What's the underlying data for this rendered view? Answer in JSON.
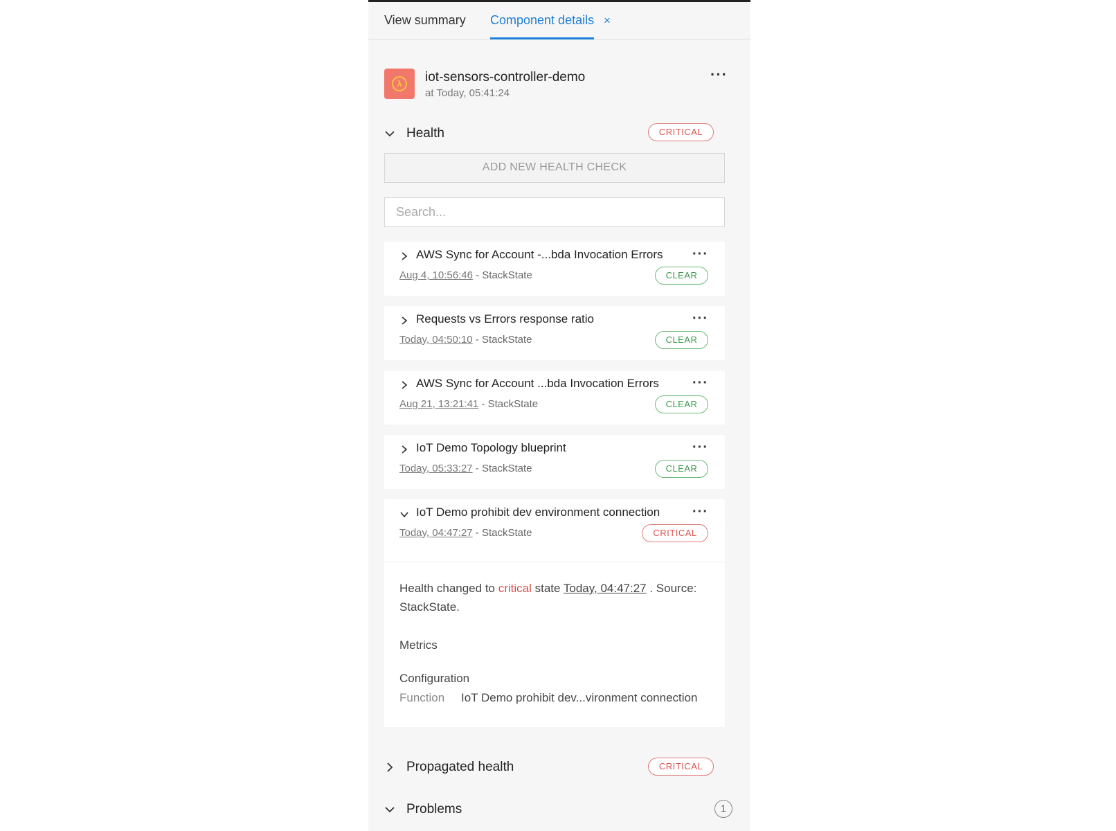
{
  "tabs": {
    "summary": "View summary",
    "details": "Component details",
    "close": "×"
  },
  "component": {
    "title": "iot-sensors-controller-demo",
    "time": "at Today, 05:41:24",
    "icon": "lambda-icon",
    "icon_color": "#f2786c"
  },
  "health": {
    "title": "Health",
    "state": "CRITICAL",
    "add_button": "ADD NEW HEALTH CHECK",
    "search_placeholder": "Search..."
  },
  "checks": [
    {
      "title": "AWS Sync for Account -...bda Invocation Errors",
      "time": "Aug 4, 10:56:46",
      "source": " - StackState",
      "state": "CLEAR"
    },
    {
      "title": "Requests vs Errors response ratio",
      "time": "Today, 04:50:10",
      "source": " - StackState",
      "state": "CLEAR"
    },
    {
      "title": "AWS Sync for Account ...bda Invocation Errors",
      "time": "Aug 21, 13:21:41",
      "source": " - StackState",
      "state": "CLEAR"
    },
    {
      "title": "IoT Demo Topology blueprint",
      "time": "Today, 05:33:27",
      "source": " - StackState",
      "state": "CLEAR"
    },
    {
      "title": "IoT Demo prohibit dev environment connection",
      "time": "Today, 04:47:27",
      "source": " - StackState",
      "state": "CRITICAL"
    }
  ],
  "detail": {
    "msg_prefix": "Health changed to ",
    "msg_state": "critical",
    "msg_mid": " state ",
    "msg_time": "Today, 04:47:27",
    "msg_suffix": " . Source: StackState.",
    "metrics_label": "Metrics",
    "config_label": "Configuration",
    "function_key": "Function",
    "function_value": "IoT Demo prohibit dev...vironment connection"
  },
  "propagated": {
    "title": "Propagated health",
    "state": "CRITICAL"
  },
  "problems": {
    "title": "Problems",
    "count": "1"
  },
  "colors": {
    "accent": "#1b7ed4",
    "critical": "#d9534f",
    "clear": "#3b9a4a"
  }
}
